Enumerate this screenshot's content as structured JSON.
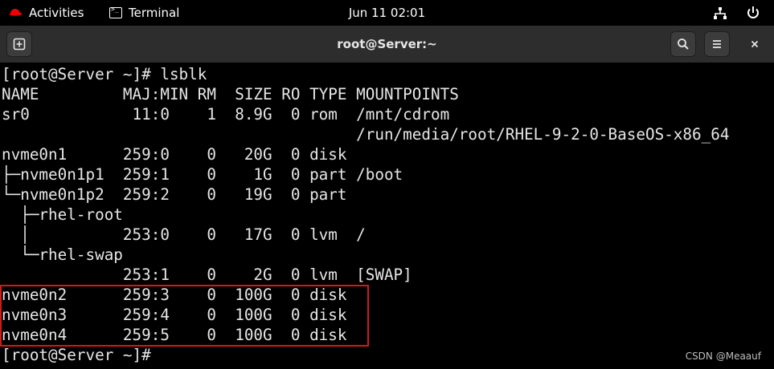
{
  "topbar": {
    "activities_label": "Activities",
    "app_label": "Terminal",
    "clock": "Jun 11  02:01"
  },
  "window": {
    "title": "root@Server:~"
  },
  "terminal": {
    "lines": [
      "[root@Server ~]# lsblk",
      "NAME         MAJ:MIN RM  SIZE RO TYPE MOUNTPOINTS",
      "sr0           11:0    1  8.9G  0 rom  /mnt/cdrom",
      "                                      /run/media/root/RHEL-9-2-0-BaseOS-x86_64",
      "nvme0n1      259:0    0   20G  0 disk",
      "├─nvme0n1p1  259:1    0    1G  0 part /boot",
      "└─nvme0n1p2  259:2    0   19G  0 part",
      "  ├─rhel-root",
      "  │          253:0    0   17G  0 lvm  /",
      "  └─rhel-swap",
      "             253:1    0    2G  0 lvm  [SWAP]",
      "nvme0n2      259:3    0  100G  0 disk",
      "nvme0n3      259:4    0  100G  0 disk",
      "nvme0n4      259:5    0  100G  0 disk",
      "[root@Server ~]# "
    ]
  },
  "watermark": "CSDN @Meaauf",
  "colors": {
    "highlight_box": "#d11a1a",
    "header_bg": "#2d2d2d",
    "terminal_bg": "#000000"
  }
}
